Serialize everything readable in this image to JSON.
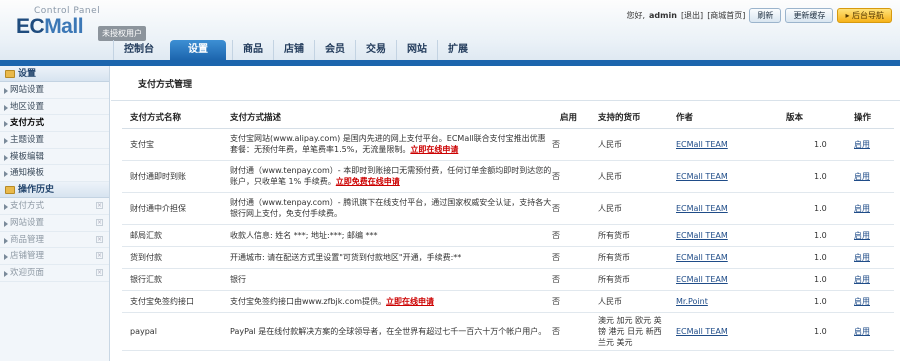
{
  "header": {
    "logo_small": "Control Panel",
    "logo_ec": "EC",
    "logo_mall": "Mall",
    "license": "未授权用户",
    "greeting": "您好,",
    "username": "admin",
    "logout": "[退出]",
    "mall_home": "[商城首页]",
    "refresh": "刷新",
    "update_cache": "更新缓存",
    "back_nav": "后台导航"
  },
  "nav": [
    "控制台",
    "设置",
    "商品",
    "店铺",
    "会员",
    "交易",
    "网站",
    "扩展"
  ],
  "sidebar": {
    "settings_title": "设置",
    "items": [
      "网站设置",
      "地区设置",
      "支付方式",
      "主题设置",
      "模板编辑",
      "通知模板"
    ],
    "history_title": "操作历史",
    "history": [
      "支付方式",
      "网站设置",
      "商品管理",
      "店铺管理",
      "欢迎页面"
    ]
  },
  "page": {
    "title": "支付方式管理",
    "columns": [
      "支付方式名称",
      "支付方式描述",
      "启用",
      "支持的货币",
      "作者",
      "版本",
      "操作"
    ],
    "rows": [
      {
        "name": "支付宝",
        "desc": "支付宝网站(www.alipay.com) 是国内先进的网上支付平台。ECMall联合支付宝推出优惠套餐：无预付年费，单笔费率1.5%，无流量限制。",
        "apply": "立即在线申请",
        "enabled": "否",
        "currency": "人民币",
        "author": "ECMall TEAM",
        "version": "1.0",
        "action": "启用"
      },
      {
        "name": "财付通即时到账",
        "desc": "财付通（www.tenpay.com）- 本即时到账接口无需预付费，任何订单金额均即时到达您的账户，只收单笔 1% 手续费。",
        "apply": "立即免费在线申请",
        "enabled": "否",
        "currency": "人民币",
        "author": "ECMall TEAM",
        "version": "1.0",
        "action": "启用"
      },
      {
        "name": "财付通中介担保",
        "desc": "财付通（www.tenpay.com）- 腾讯旗下在线支付平台，通过国家权威安全认证，支持各大银行网上支付，免支付手续费。",
        "apply": "",
        "enabled": "否",
        "currency": "人民币",
        "author": "ECMall TEAM",
        "version": "1.0",
        "action": "启用"
      },
      {
        "name": "邮局汇款",
        "desc": "收款人信息: 姓名 ***; 地址:***; 邮编 ***",
        "apply": "",
        "enabled": "否",
        "currency": "所有货币",
        "author": "ECMall TEAM",
        "version": "1.0",
        "action": "启用"
      },
      {
        "name": "货到付款",
        "desc": "开通城市: 请在配送方式里设置\"可货到付款地区\"开通，手续费:**",
        "apply": "",
        "enabled": "否",
        "currency": "所有货币",
        "author": "ECMall TEAM",
        "version": "1.0",
        "action": "启用"
      },
      {
        "name": "银行汇款",
        "desc": "银行",
        "apply": "",
        "enabled": "否",
        "currency": "所有货币",
        "author": "ECMall TEAM",
        "version": "1.0",
        "action": "启用"
      },
      {
        "name": "支付宝免签约接口",
        "desc": "支付宝免签约接口由www.zfbjk.com提供。",
        "apply": "立即在线申请",
        "enabled": "否",
        "currency": "人民币",
        "author": "Mr.Point",
        "version": "1.0",
        "action": "启用"
      },
      {
        "name": "paypal",
        "desc": "PayPal 是在线付款解决方案的全球领导者，在全世界有超过七千一百六十万个帐户用户。",
        "apply": "",
        "enabled": "否",
        "currency": "澳元 加元 欧元 英镑 港元 日元 新西兰元 美元",
        "author": "ECMall TEAM",
        "version": "1.0",
        "action": "启用"
      }
    ]
  }
}
